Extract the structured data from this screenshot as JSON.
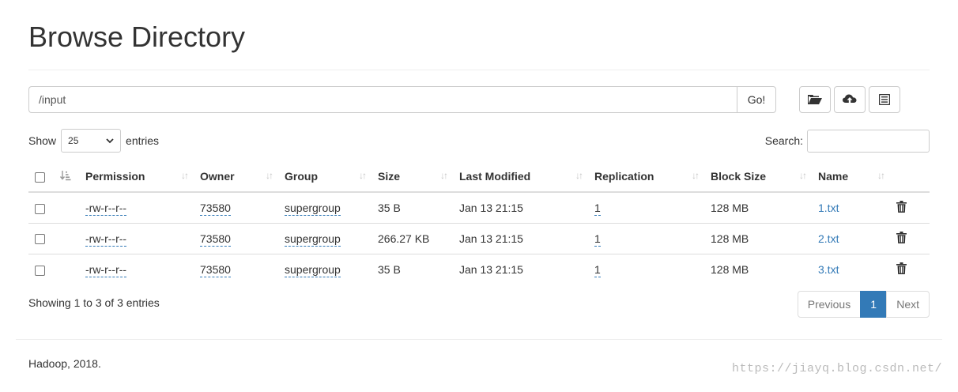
{
  "page": {
    "title": "Browse Directory"
  },
  "path_bar": {
    "value": "/input",
    "go_label": "Go!"
  },
  "toolbar": {
    "icons": [
      "folder-open-icon",
      "cloud-upload-icon",
      "list-alt-icon"
    ]
  },
  "length": {
    "show_label": "Show",
    "selected": "25",
    "entries_label": "entries"
  },
  "search": {
    "label": "Search:",
    "value": ""
  },
  "table": {
    "columns": [
      "Permission",
      "Owner",
      "Group",
      "Size",
      "Last Modified",
      "Replication",
      "Block Size",
      "Name"
    ],
    "rows": [
      {
        "permission": "-rw-r--r--",
        "owner": "73580",
        "group": "supergroup",
        "size": "35 B",
        "modified": "Jan 13 21:15",
        "replication": "1",
        "block_size": "128 MB",
        "name": "1.txt"
      },
      {
        "permission": "-rw-r--r--",
        "owner": "73580",
        "group": "supergroup",
        "size": "266.27 KB",
        "modified": "Jan 13 21:15",
        "replication": "1",
        "block_size": "128 MB",
        "name": "2.txt"
      },
      {
        "permission": "-rw-r--r--",
        "owner": "73580",
        "group": "supergroup",
        "size": "35 B",
        "modified": "Jan 13 21:15",
        "replication": "1",
        "block_size": "128 MB",
        "name": "3.txt"
      }
    ]
  },
  "info": {
    "text": "Showing 1 to 3 of 3 entries"
  },
  "pagination": {
    "previous": "Previous",
    "current": "1",
    "next": "Next"
  },
  "footer": {
    "text": "Hadoop, 2018."
  },
  "watermark": {
    "text": "https://jiayq.blog.csdn.net/"
  },
  "colors": {
    "link": "#337ab7",
    "active_page": "#337ab7",
    "border": "#dddddd"
  }
}
